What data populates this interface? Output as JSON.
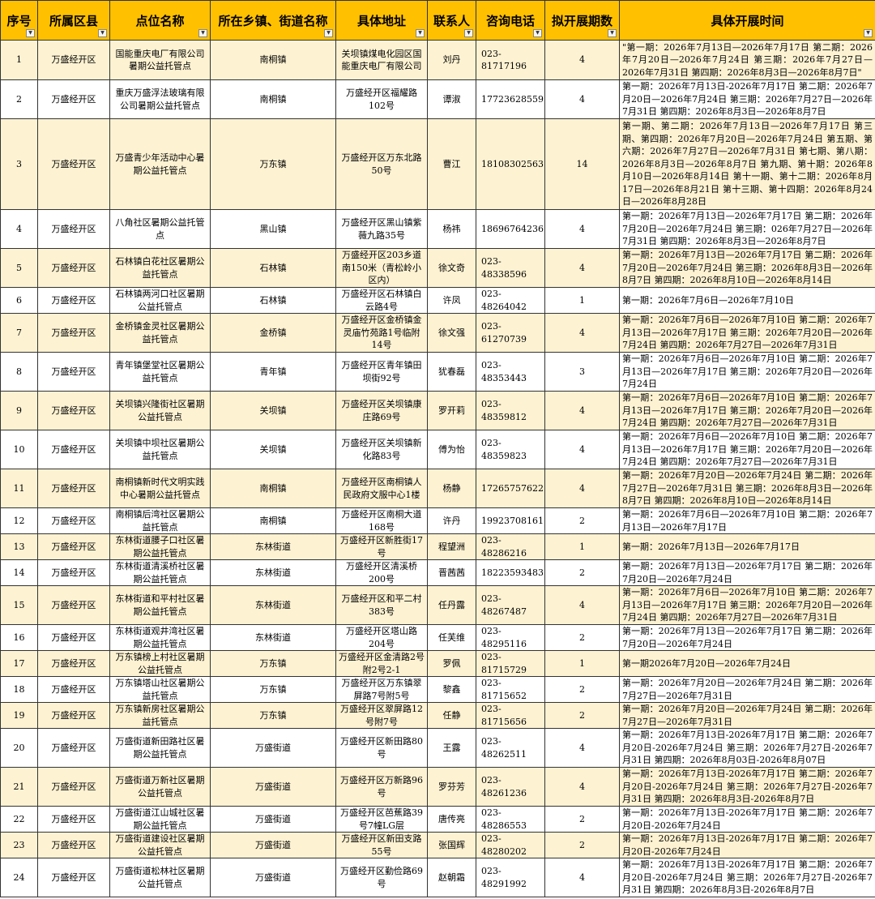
{
  "headers": [
    "序号",
    "所属区县",
    "点位名称",
    "所在乡镇、街道名称",
    "具体地址",
    "联系人",
    "咨询电话",
    "拟开展期数",
    "具体开展时间"
  ],
  "filter_icon": "dropdown-arrow-icon",
  "colors": {
    "header_bg": "#FFC000",
    "band_bg": "#FDF2D2",
    "border": "#333333"
  },
  "rows": [
    {
      "no": "1",
      "district": "万盛经开区",
      "name": "国能重庆电厂有限公司暑期公益托管点",
      "town": "南桐镇",
      "address": "关坝镇煤电化园区国能重庆电厂有限公司",
      "contact": "刘丹",
      "phone": "023-81717196",
      "periods": "4",
      "time": "\"第一期：2026年7月13日—2026年7月17日 第二期：2026年7月20日—2026年7月24日 第三期：2026年7月27日—2026年7月31日 第四期：2026年8月3日—2026年8月7日\""
    },
    {
      "no": "2",
      "district": "万盛经开区",
      "name": "重庆万盛浮法玻璃有限公司暑期公益托管点",
      "town": "南桐镇",
      "address": "万盛经开区福耀路102号",
      "contact": "谭淑",
      "phone": "17723628559",
      "periods": "4",
      "time": "第一期：2026年7月13日-2026年7月17日 第二期：2026年7月20日—2026年7月24日 第三期：2026年7月27日—2026年7月31日 第四期：2026年8月3日—2026年8月7日"
    },
    {
      "no": "3",
      "district": "万盛经开区",
      "name": "万盛青少年活动中心暑期公益托管点",
      "town": "万东镇",
      "address": "万盛经开区万东北路50号",
      "contact": "曹江",
      "phone": "18108302563",
      "periods": "14",
      "time": "第一期、第二期：2026年7月13日—2026年7月17日 第三期、第四期：2026年7月20日—2026年7月24日 第五期、第六期：2026年7月27日—2026年7月31日 第七期、第八期：2026年8月3日—2026年8月7日 第九期、第十期：2026年8月10日—2026年8月14日 第十一期、第十二期：2026年8月17日—2026年8月21日 第十三期、第十四期：2026年8月24日—2026年8月28日"
    },
    {
      "no": "4",
      "district": "万盛经开区",
      "name": "八角社区暑期公益托管点",
      "town": "黑山镇",
      "address": "万盛经开区黑山镇紫薇九路35号",
      "contact": "杨祎",
      "phone": "18696764236",
      "periods": "4",
      "time": "第一期：2026年7月13日—2026年7月17日 第二期：2026年7月20日—2026年7月24日 第三期：026年7月27日—2026年7月31日 第四期：2026年8月3日—2026年8月7日"
    },
    {
      "no": "5",
      "district": "万盛经开区",
      "name": "石林镇白花社区暑期公益托管点",
      "town": "石林镇",
      "address": "万盛经开区203乡道南150米（青松岭小区内）",
      "contact": "徐文奇",
      "phone": "023-48338596",
      "periods": "4",
      "time": "第一期：2026年7月13日—2026年7月17日 第二期：2026年7月20日—2026年7月24日 第三期：2026年8月3日—2026年8月7日 第四期：2026年8月10日—2026年8月14日"
    },
    {
      "no": "6",
      "district": "万盛经开区",
      "name": "石林镇两河口社区暑期公益托管点",
      "town": "石林镇",
      "address": "万盛经开区石林镇白云路4号",
      "contact": "许凤",
      "phone": "023-48264042",
      "periods": "1",
      "time": "第一期：2026年7月6日—2026年7月10日"
    },
    {
      "no": "7",
      "district": "万盛经开区",
      "name": "金桥镇金灵社区暑期公益托管点",
      "town": "金桥镇",
      "address": "万盛经开区金桥镇金灵庙竹苑路1号临附14号",
      "contact": "徐文强",
      "phone": "023-61270739",
      "periods": "4",
      "time": "第一期：2026年7月6日—2026年7月10日 第二期：2026年7月13日—2026年7月17日 第三期：2026年7月20日—2026年7月24日 第四期：2026年7月27日—2026年7月31日"
    },
    {
      "no": "8",
      "district": "万盛经开区",
      "name": "青年镇堡堂社区暑期公益托管点",
      "town": "青年镇",
      "address": "万盛经开区青年镇田坝街92号",
      "contact": "犹春磊",
      "phone": "023-48353443",
      "periods": "3",
      "time": "第一期：2026年7月6日—2026年7月10日 第二期：2026年7月13日—2026年7月17日 第三期：2026年7月20日—2026年7月24日"
    },
    {
      "no": "9",
      "district": "万盛经开区",
      "name": "关坝镇兴隆街社区暑期公益托管点",
      "town": "关坝镇",
      "address": "万盛经开区关坝镇康庄路69号",
      "contact": "罗开莉",
      "phone": "023-48359812",
      "periods": "4",
      "time": "第一期：2026年7月6日—2026年7月10日 第二期：2026年7月13日—2026年7月17日 第三期：2026年7月20日—2026年7月24日 第四期：2026年7月27日—2026年7月31日"
    },
    {
      "no": "10",
      "district": "万盛经开区",
      "name": "关坝镇中坝社区暑期公益托管点",
      "town": "关坝镇",
      "address": "万盛经开区关坝镇新化路83号",
      "contact": "傅为怡",
      "phone": "023-48359823",
      "periods": "4",
      "time": "第一期：2026年7月6日—2026年7月10日 第二期：2026年7月13日—2026年7月17日 第三期：2026年7月20日—2026年7月24日 第四期：2026年7月27日—2026年7月31日"
    },
    {
      "no": "11",
      "district": "万盛经开区",
      "name": "南桐镇新时代文明实践中心暑期公益托管点",
      "town": "南桐镇",
      "address": "万盛经开区南桐镇人民政府文服中心1楼",
      "contact": "杨静",
      "phone": "17265757622",
      "periods": "4",
      "time": "第一期：2026年7月20日—2026年7月24日 第二期：2026年7月27日—2026年7月31日 第三期：2026年8月3日—2026年8月7日 第四期：2026年8月10日—2026年8月14日"
    },
    {
      "no": "12",
      "district": "万盛经开区",
      "name": "南桐镇后湾社区暑期公益托管点",
      "town": "南桐镇",
      "address": "万盛经开区南桐大道168号",
      "contact": "许丹",
      "phone": "19923708161",
      "periods": "2",
      "time": "第一期：2026年7月6日—2026年7月10日 第二期：2026年7月13日—2026年7月17日"
    },
    {
      "no": "13",
      "district": "万盛经开区",
      "name": "东林街道腰子口社区暑期公益托管点",
      "town": "东林街道",
      "address": "万盛经开区新胜街17号",
      "contact": "程望洲",
      "phone": "023-48286216",
      "periods": "1",
      "time": "第一期：2026年7月13日—2026年7月17日"
    },
    {
      "no": "14",
      "district": "万盛经开区",
      "name": "东林街道清溪桥社区暑期公益托管点",
      "town": "东林街道",
      "address": "万盛经开区清溪桥200号",
      "contact": "晋茜茜",
      "phone": "18223593483",
      "periods": "2",
      "time": "第一期：2026年7月13日—2026年7月17日 第二期：2026年7月20日—2026年7月24日"
    },
    {
      "no": "15",
      "district": "万盛经开区",
      "name": "东林街道和平村社区暑期公益托管点",
      "town": "东林街道",
      "address": "万盛经开区和平二村383号",
      "contact": "任丹露",
      "phone": "023-48267487",
      "periods": "4",
      "time": "第一期：2026年7月6日—2026年7月10日 第二期：2026年7月13日—2026年7月17日 第三期：2026年7月20日—2026年7月24日 第四期：2026年7月27日—2026年7月31日"
    },
    {
      "no": "16",
      "district": "万盛经开区",
      "name": "东林街道观井湾社区暑期公益托管点",
      "town": "东林街道",
      "address": "万盛经开区塔山路204号",
      "contact": "任芙维",
      "phone": "023-48295116",
      "periods": "2",
      "time": "第一期：2026年7月13日—2026年7月17日 第二期：2026年7月20日—2026年7月24日"
    },
    {
      "no": "17",
      "district": "万盛经开区",
      "name": "万东镇榜上村社区暑期公益托管点",
      "town": "万东镇",
      "address": "万盛经开区金清路2号附2号2-1",
      "contact": "罗佩",
      "phone": "023-81715729",
      "periods": "1",
      "time": "第一期2026年7月20日—2026年7月24日"
    },
    {
      "no": "18",
      "district": "万盛经开区",
      "name": "万东镇塔山社区暑期公益托管点",
      "town": "万东镇",
      "address": "万盛经开区万东镇翠屏路7号附5号",
      "contact": "黎鑫",
      "phone": "023-81715652",
      "periods": "2",
      "time": "第一期：2026年7月20日—2026年7月24日 第二期：2026年7月27日—2026年7月31日"
    },
    {
      "no": "19",
      "district": "万盛经开区",
      "name": "万东镇新房社区暑期公益托管点",
      "town": "万东镇",
      "address": "万盛经开区翠屏路12号附7号",
      "contact": "任静",
      "phone": "023-81715656",
      "periods": "2",
      "time": "第一期：2026年7月20日—2026年7月24日 第二期：2026年7月27日—2026年7月31日"
    },
    {
      "no": "20",
      "district": "万盛经开区",
      "name": "万盛街道新田路社区暑期公益托管点",
      "town": "万盛街道",
      "address": "万盛经开区新田路80号",
      "contact": "王露",
      "phone": "023-48262511",
      "periods": "4",
      "time": "第一期：2026年7月13日-2026年7月17日 第二期：2026年7月20日-2026年7月24日 第三期：2026年7月27日-2026年7月31日 第四期：2026年8月03日-2026年8月07日"
    },
    {
      "no": "21",
      "district": "万盛经开区",
      "name": "万盛街道万新社区暑期公益托管点",
      "town": "万盛街道",
      "address": "万盛经开区万新路96号",
      "contact": "罗芬芳",
      "phone": "023-48261236",
      "periods": "4",
      "time": "第一期：2026年7月13日-2026年7月17日 第二期：2026年7月20日-2026年7月24日 第三期：2026年7月27日-2026年7月31日 第四期：2026年8月3日-2026年8月7日"
    },
    {
      "no": "22",
      "district": "万盛经开区",
      "name": "万盛街道江山城社区暑期公益托管点",
      "town": "万盛街道",
      "address": "万盛经开区芭蕉路39号7幢LG层",
      "contact": "唐传亮",
      "phone": "023-48286553",
      "periods": "2",
      "time": "第一期：2026年7月13日-2026年7月17日 第二期：2026年7月20日-2026年7月24日"
    },
    {
      "no": "23",
      "district": "万盛经开区",
      "name": "万盛街道建设社区暑期公益托管点",
      "town": "万盛街道",
      "address": "万盛经开区新田支路55号",
      "contact": "张国辉",
      "phone": "023-48280202",
      "periods": "2",
      "time": "第一期：2026年7月13日-2026年7月17日 第二期：2026年7月20日-2026年7月24日"
    },
    {
      "no": "24",
      "district": "万盛经开区",
      "name": "万盛街道松林社区暑期公益托管点",
      "town": "万盛街道",
      "address": "万盛经开区勤俭路69号",
      "contact": "赵朝霜",
      "phone": "023-48291992",
      "periods": "4",
      "time": "第一期：2026年7月13日-2026年7月17日 第二期：2026年7月20日-2026年7月24日 第三期：2026年7月27日-2026年7月31日 第四期：2026年8月3日-2026年8月7日"
    }
  ]
}
